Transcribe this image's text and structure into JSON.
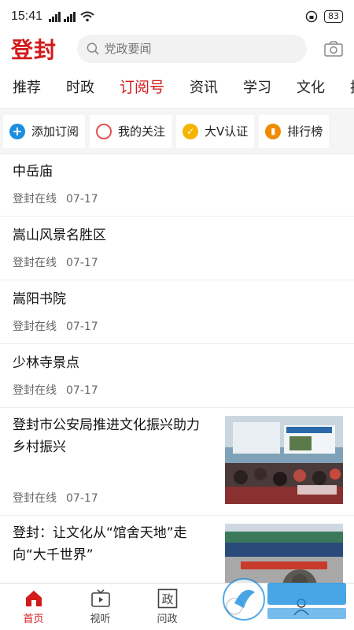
{
  "status": {
    "time": "15:41",
    "battery": "83"
  },
  "header": {
    "logo": "登封",
    "search_placeholder": "党政要闻"
  },
  "tabs": [
    {
      "label": "推荐",
      "active": false
    },
    {
      "label": "时政",
      "active": false
    },
    {
      "label": "订阅号",
      "active": true
    },
    {
      "label": "资讯",
      "active": false
    },
    {
      "label": "学习",
      "active": false
    },
    {
      "label": "文化",
      "active": false
    },
    {
      "label": "拍",
      "active": false
    }
  ],
  "subbar": [
    {
      "label": "添加订阅",
      "icon": "plus-icon",
      "color": "#1a8fe0"
    },
    {
      "label": "我的关注",
      "icon": "circle-icon",
      "color": "#e05050"
    },
    {
      "label": "大V认证",
      "icon": "check-icon",
      "color": "#f5b400"
    },
    {
      "label": "排行榜",
      "icon": "bar-chart-icon",
      "color": "#f08a00"
    }
  ],
  "news": [
    {
      "title": "中岳庙",
      "source": "登封在线",
      "date": "07-17"
    },
    {
      "title": "嵩山风景名胜区",
      "source": "登封在线",
      "date": "07-17"
    },
    {
      "title": "嵩阳书院",
      "source": "登封在线",
      "date": "07-17"
    },
    {
      "title": "少林寺景点",
      "source": "登封在线",
      "date": "07-17"
    },
    {
      "title": "登封市公安局推进文化振兴助力乡村振兴",
      "source": "登封在线",
      "date": "07-17"
    },
    {
      "title": "登封：让文化从“馆舍天地”走向“大千世界”",
      "source": "",
      "date": ""
    }
  ],
  "bottom_nav": [
    {
      "label": "首页",
      "active": true
    },
    {
      "label": "视听",
      "active": false
    },
    {
      "label": "问政",
      "active": false
    },
    {
      "label": "",
      "active": false
    },
    {
      "label": "",
      "active": false
    }
  ],
  "colors": {
    "accent": "#d21a1a"
  }
}
